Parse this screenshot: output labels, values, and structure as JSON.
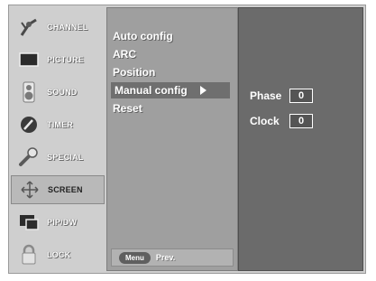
{
  "sidebar": {
    "items": [
      {
        "label": "CHANNEL",
        "icon": "antenna-icon",
        "active": false
      },
      {
        "label": "PICTURE",
        "icon": "tv-screen-icon",
        "active": false
      },
      {
        "label": "SOUND",
        "icon": "speaker-icon",
        "active": false
      },
      {
        "label": "TIMER",
        "icon": "clock-hand-icon",
        "active": false
      },
      {
        "label": "SPECIAL",
        "icon": "wrench-icon",
        "active": false
      },
      {
        "label": "SCREEN",
        "icon": "screen-adjust-icon",
        "active": true
      },
      {
        "label": "PIP/DW",
        "icon": "pip-icon",
        "active": false
      },
      {
        "label": "LOCK",
        "icon": "lock-icon",
        "active": false
      }
    ]
  },
  "menu": {
    "items": [
      {
        "label": "Auto config"
      },
      {
        "label": "ARC"
      },
      {
        "label": "Position"
      },
      {
        "label": "Manual config",
        "selected": true
      },
      {
        "label": "Reset"
      }
    ]
  },
  "footer": {
    "menu_button": "Menu",
    "prev_label": "Prev."
  },
  "params": [
    {
      "label": "Phase",
      "value": "0"
    },
    {
      "label": "Clock",
      "value": "0"
    }
  ]
}
